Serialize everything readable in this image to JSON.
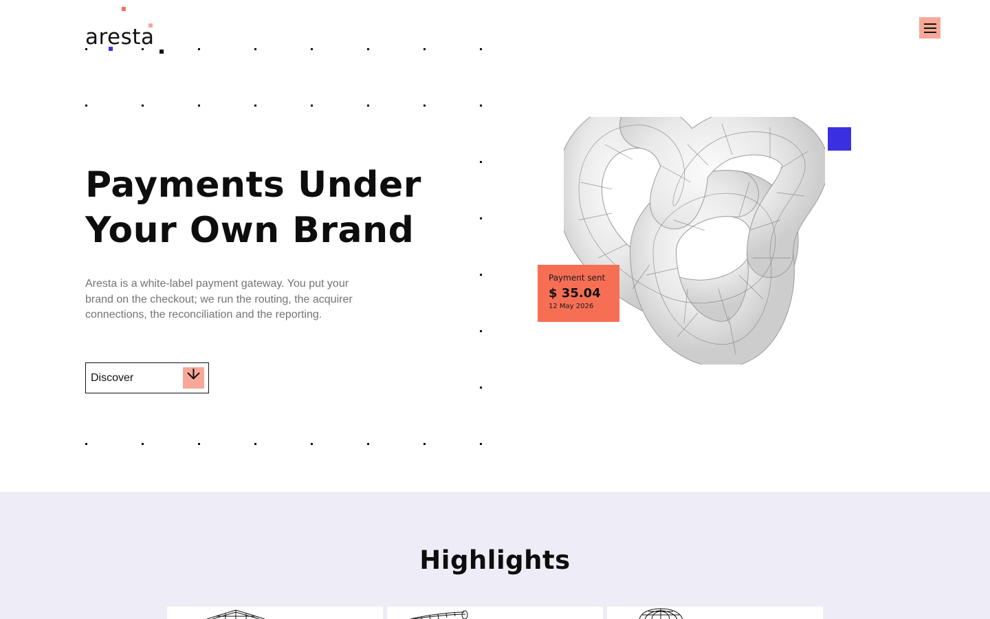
{
  "logo": {
    "text": "aresta"
  },
  "header": {
    "menu_icon": "hamburger-menu-icon"
  },
  "hero": {
    "headline": [
      "Payments Under",
      "Your Own Brand"
    ],
    "intro": "Aresta is a white-label payment gateway. You put your brand on the checkout; we run the routing, the acquirer connections, the reconciliation and the reporting.",
    "cta_label": "Discover",
    "cta_icon": "arrow-down-icon",
    "illustration_icon": "torus-knot-icon"
  },
  "payment_card": {
    "label": "Payment sent",
    "amount": "$ 35.04",
    "date": "12 May 2026"
  },
  "highlights": {
    "title": "Highlights",
    "cards": [
      {
        "icon": "wireframe-cube-icon"
      },
      {
        "icon": "wireframe-cylinder-icon"
      },
      {
        "icon": "wireframe-sphere-icon"
      }
    ]
  },
  "colors": {
    "coral": "#f66f55",
    "salmon": "#f8a898",
    "blue": "#3b30e0",
    "lavender": "#eeedf7",
    "text": "#111111",
    "muted": "#737373"
  }
}
